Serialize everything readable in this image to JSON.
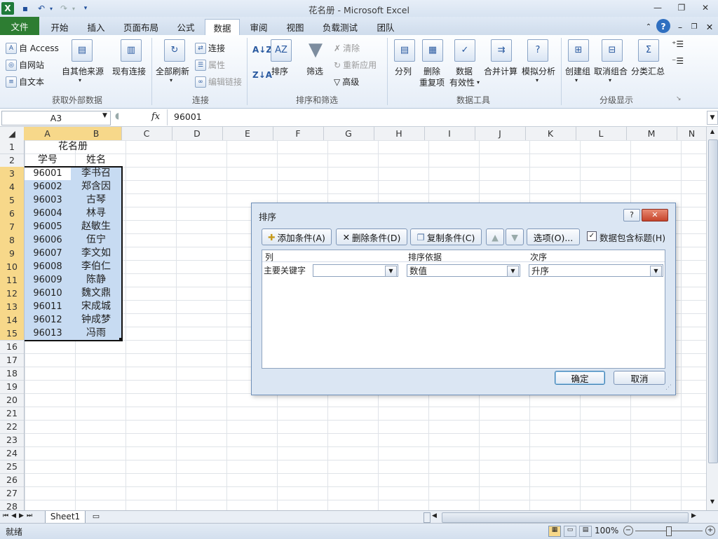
{
  "window": {
    "title": "花名册  -  Microsoft Excel"
  },
  "qat": {
    "app_icon": "excel-icon",
    "save": "save-icon",
    "undo": "undo-icon",
    "redo": "redo-icon",
    "customize": "dropdown-icon"
  },
  "window_controls": {
    "minimize": "—",
    "restore": "❐",
    "close": "✕"
  },
  "ribbon_tabs": [
    "文件",
    "开始",
    "插入",
    "页面布局",
    "公式",
    "数据",
    "审阅",
    "视图",
    "负载测试",
    "团队"
  ],
  "active_tab": "数据",
  "ribbon": {
    "groups": {
      "external": {
        "label": "获取外部数据",
        "access": "自 Access",
        "web": "自网站",
        "text": "自文本",
        "other": "自其他来源",
        "existing": "现有连接"
      },
      "connections": {
        "label": "连接",
        "refresh_all": "全部刷新",
        "connections": "连接",
        "properties": "属性",
        "edit_links": "编辑链接"
      },
      "sort_filter": {
        "label": "排序和筛选",
        "sort_az": "A↓Z",
        "sort_za": "Z↓A",
        "sort": "排序",
        "filter": "筛选",
        "clear": "清除",
        "reapply": "重新应用",
        "advanced": "高级"
      },
      "data_tools": {
        "label": "数据工具",
        "text_to_columns": "分列",
        "remove_duplicates_1": "删除",
        "remove_duplicates_2": "重复项",
        "validation_1": "数据",
        "validation_2": "有效性",
        "consolidate": "合并计算",
        "what_if": "模拟分析"
      },
      "outline": {
        "label": "分级显示",
        "group": "创建组",
        "ungroup": "取消组合",
        "subtotal": "分类汇总"
      }
    }
  },
  "formula_bar": {
    "name_box": "A3",
    "fx": "fx",
    "value": "96001"
  },
  "columns": [
    "A",
    "B",
    "C",
    "D",
    "E",
    "F",
    "G",
    "H",
    "I",
    "J",
    "K",
    "L",
    "M",
    "N"
  ],
  "rows": [
    "1",
    "2",
    "3",
    "4",
    "5",
    "6",
    "7",
    "8",
    "9",
    "10",
    "11",
    "12",
    "13",
    "14",
    "15",
    "16",
    "17",
    "18",
    "19",
    "20",
    "21",
    "22",
    "23",
    "24",
    "25",
    "26",
    "27",
    "28"
  ],
  "sheet": {
    "title": "花名册",
    "header": {
      "id": "学号",
      "name": "姓名"
    },
    "records": [
      {
        "id": "96001",
        "name": "李书召"
      },
      {
        "id": "96002",
        "name": "郑含因"
      },
      {
        "id": "96003",
        "name": "古琴"
      },
      {
        "id": "96004",
        "name": "林寻"
      },
      {
        "id": "96005",
        "name": "赵敏生"
      },
      {
        "id": "96006",
        "name": "伍宁"
      },
      {
        "id": "96007",
        "name": "李文如"
      },
      {
        "id": "96008",
        "name": "李伯仁"
      },
      {
        "id": "96009",
        "name": "陈静"
      },
      {
        "id": "96010",
        "name": "魏文鼎"
      },
      {
        "id": "96011",
        "name": "宋成城"
      },
      {
        "id": "96012",
        "name": "钟成梦"
      },
      {
        "id": "96013",
        "name": "冯雨"
      }
    ]
  },
  "sheet_tabs": {
    "active": "Sheet1"
  },
  "status_bar": {
    "ready": "就绪",
    "zoom": "100%"
  },
  "sort_dialog": {
    "title": "排序",
    "help": "?",
    "close": "✕",
    "add_level": "添加条件(A)",
    "delete_level": "删除条件(D)",
    "copy_level": "复制条件(C)",
    "options": "选项(O)...",
    "has_headers": "数据包含标题(H)",
    "has_headers_checked": true,
    "col_header_column": "列",
    "col_header_sort_on": "排序依据",
    "col_header_order": "次序",
    "row_label": "主要关键字",
    "key_value": "",
    "sort_on_value": "数值",
    "order_value": "升序",
    "ok": "确定",
    "cancel": "取消"
  },
  "colors": {
    "accent": "#2d7d32",
    "selection_header": "#f7d88a",
    "selection_fill": "#c7dbf2"
  }
}
